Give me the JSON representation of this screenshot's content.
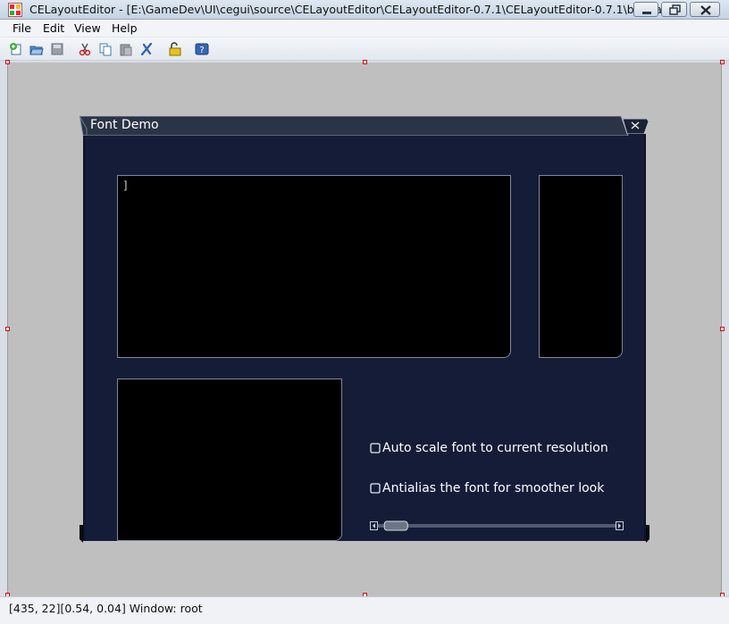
{
  "window": {
    "title": "CELayoutEditor - [E:\\GameDev\\UI\\cegui\\source\\CELayoutEditor\\CELayoutEditor-0.7.1\\CELayoutEditor-0.7.1\\bin\\da...",
    "app_icon": "celayouteditor-icon",
    "buttons": [
      "minimize-icon",
      "maximize-icon",
      "close-icon"
    ]
  },
  "menu": {
    "file": "File",
    "edit": "Edit",
    "view": "View",
    "help": "Help"
  },
  "toolbar": {
    "icons": [
      "new-layout-icon",
      "open-icon",
      "save-icon",
      "cut-icon",
      "copy-icon",
      "paste-icon",
      "delete-icon",
      "lock-icon",
      "help-icon"
    ]
  },
  "font_demo": {
    "title": "Font Demo",
    "edit_text": "]",
    "checkbox_auto_scale": "Auto scale font to current resolution",
    "checkbox_antialias": "Antialias the font for smoother look",
    "auto_scale_checked": false,
    "antialias_checked": false,
    "slider_value": 0.03
  },
  "status": {
    "text": "[435, 22][0.54, 0.04] Window: root"
  },
  "colors": {
    "canvas": "#bfbfbf",
    "window_body": "#141c38",
    "window_titlebar": "#2a3446",
    "selection_handle": "#e00000"
  }
}
